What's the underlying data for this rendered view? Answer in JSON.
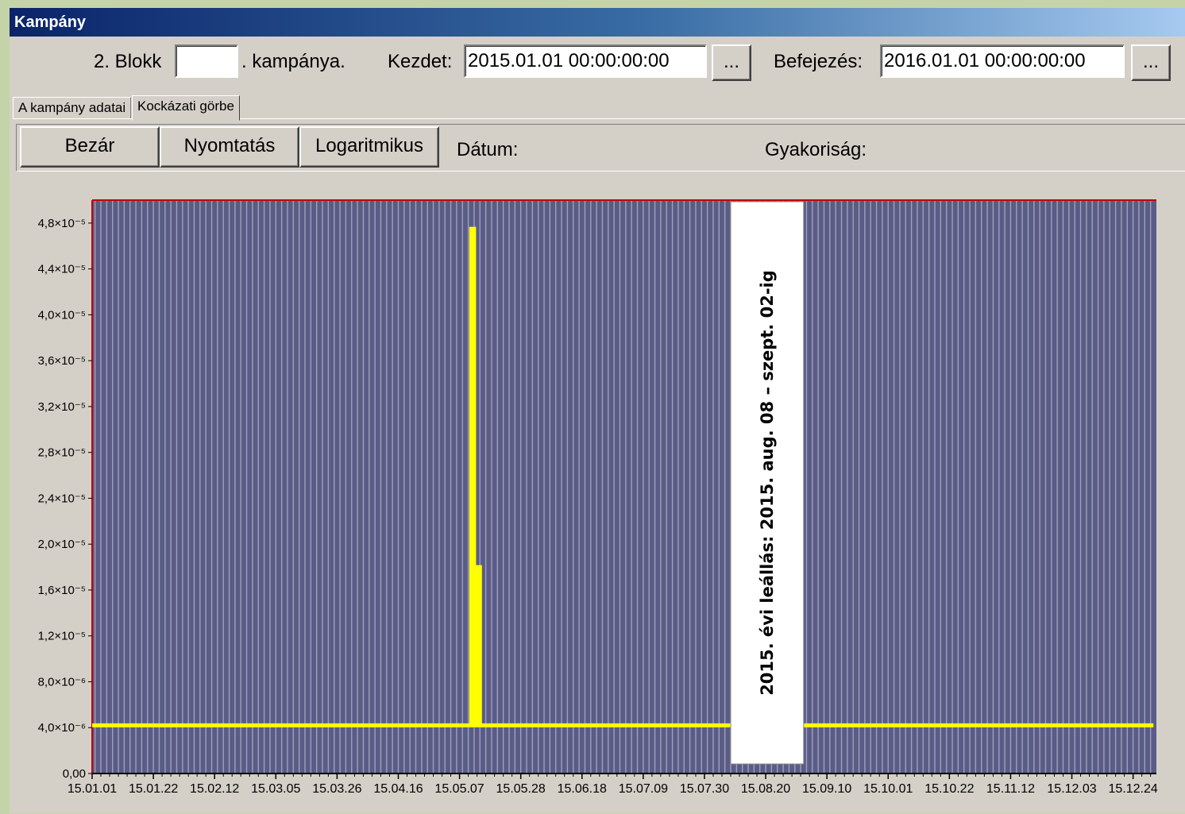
{
  "window": {
    "title": "Kampány"
  },
  "header": {
    "block_label": "2. Blokk",
    "block_value": "",
    "campaign_label": ". kampánya.",
    "start_label": "Kezdet:",
    "start_value": "2015.01.01 00:00:00:00",
    "start_picker": "...",
    "end_label": "Befejezés:",
    "end_value": "2016.01.01 00:00:00:00",
    "end_picker": "..."
  },
  "tabs": [
    {
      "label": "A kampány adatai",
      "active": false
    },
    {
      "label": "Kockázati görbe",
      "active": true
    }
  ],
  "toolbar": {
    "close": "Bezár",
    "print": "Nyomtatás",
    "log": "Logaritmikus",
    "date_label": "Dátum:",
    "freq_label": "Gyakoriság:"
  },
  "colors": {
    "plot_bg": "#5a5c86",
    "grid": "#9fa0bd",
    "series": "#ffff00",
    "plot_border_top": "#cc0000",
    "plot_border_left": "#cc0000"
  },
  "chart_data": {
    "type": "line",
    "x_axis": "date",
    "x_start": "2015-01-01",
    "x_end": "2016-01-01",
    "ylim": [
      0,
      5e-05
    ],
    "y_ticks": [
      {
        "value": 0,
        "label": "0,00"
      },
      {
        "value": 4e-06,
        "label": "4,0×10⁻⁶"
      },
      {
        "value": 8e-06,
        "label": "8,0×10⁻⁶"
      },
      {
        "value": 1.2e-05,
        "label": "1,2×10⁻⁵"
      },
      {
        "value": 1.6e-05,
        "label": "1,6×10⁻⁵"
      },
      {
        "value": 2e-05,
        "label": "2,0×10⁻⁵"
      },
      {
        "value": 2.4e-05,
        "label": "2,4×10⁻⁵"
      },
      {
        "value": 2.8e-05,
        "label": "2,8×10⁻⁵"
      },
      {
        "value": 3.2e-05,
        "label": "3,2×10⁻⁵"
      },
      {
        "value": 3.6e-05,
        "label": "3,6×10⁻⁵"
      },
      {
        "value": 4e-05,
        "label": "4,0×10⁻⁵"
      },
      {
        "value": 4.4e-05,
        "label": "4,4×10⁻⁵"
      },
      {
        "value": 4.8e-05,
        "label": "4,8×10⁻⁵"
      }
    ],
    "x_ticks": [
      {
        "date": "2015-01-01",
        "label": "15.01.01"
      },
      {
        "date": "2015-01-22",
        "label": "15.01.22"
      },
      {
        "date": "2015-02-12",
        "label": "15.02.12"
      },
      {
        "date": "2015-03-05",
        "label": "15.03.05"
      },
      {
        "date": "2015-03-26",
        "label": "15.03.26"
      },
      {
        "date": "2015-04-16",
        "label": "15.04.16"
      },
      {
        "date": "2015-05-07",
        "label": "15.05.07"
      },
      {
        "date": "2015-05-28",
        "label": "15.05.28"
      },
      {
        "date": "2015-06-18",
        "label": "15.06.18"
      },
      {
        "date": "2015-07-09",
        "label": "15.07.09"
      },
      {
        "date": "2015-07-30",
        "label": "15.07.30"
      },
      {
        "date": "2015-08-20",
        "label": "15.08.20"
      },
      {
        "date": "2015-09-10",
        "label": "15.09.10"
      },
      {
        "date": "2015-10-01",
        "label": "15.10.01"
      },
      {
        "date": "2015-10-22",
        "label": "15.10.22"
      },
      {
        "date": "2015-11-12",
        "label": "15.11.12"
      },
      {
        "date": "2015-12-03",
        "label": "15.12.03"
      },
      {
        "date": "2015-12-24",
        "label": "15.12.24"
      }
    ],
    "series": [
      {
        "points": [
          {
            "date": "2015-01-01",
            "value": 4.2e-06
          },
          {
            "date": "2015-05-11",
            "value": 4.2e-06
          },
          {
            "date": "2015-05-11",
            "value": 4.75e-05
          },
          {
            "date": "2015-05-12",
            "value": 4.75e-05
          },
          {
            "date": "2015-05-12",
            "value": 4.2e-06
          },
          {
            "date": "2015-05-13",
            "value": 4.2e-06
          },
          {
            "date": "2015-05-13",
            "value": 1.8e-05
          },
          {
            "date": "2015-05-14",
            "value": 1.8e-05
          },
          {
            "date": "2015-05-14",
            "value": 4.2e-06
          },
          {
            "date": "2015-08-08",
            "value": 4.2e-06
          },
          {
            "date": "2015-09-02",
            "value": 4.2e-06
          },
          {
            "date": "2015-12-31",
            "value": 4.2e-06
          }
        ]
      }
    ],
    "annotation": {
      "text": "2015. évi leállás: 2015. aug. 08 – szept. 02-ig",
      "from": "2015-08-08",
      "to": "2015-09-02"
    },
    "grid": true
  }
}
